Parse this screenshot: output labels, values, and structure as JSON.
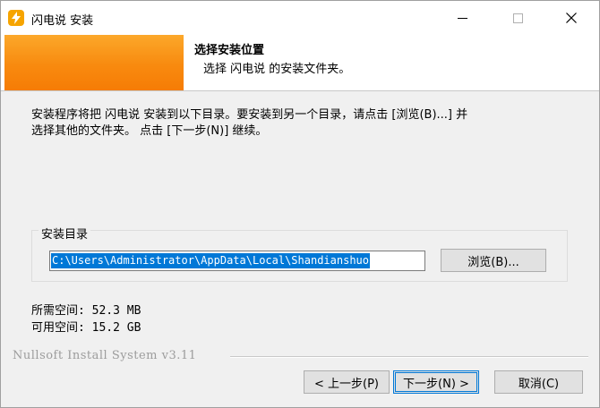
{
  "window": {
    "title": "闪电说 安装",
    "controls": {
      "minimize_icon": "minimize-icon",
      "maximize_icon": "maximize-icon",
      "close_icon": "close-icon"
    }
  },
  "header": {
    "title": "选择安装位置",
    "subtitle": "选择 闪电说 的安装文件夹。",
    "brand_color": "#f88a0f"
  },
  "body": {
    "intro_line1": "安装程序将把 闪电说 安装到以下目录。要安装到另一个目录，请点击 [浏览(B)...] 并",
    "intro_line2": "选择其他的文件夹。 点击 [下一步(N)] 继续。"
  },
  "install_dir": {
    "label": "安装目录",
    "value": "C:\\Users\\Administrator\\AppData\\Local\\Shandianshuo",
    "browse_label": "浏览(B)..."
  },
  "space": {
    "required": "所需空间: 52.3 MB",
    "available": "可用空间: 15.2 GB"
  },
  "footer": {
    "branding": "Nullsoft Install System v3.11",
    "back_label": "< 上一步(P)",
    "next_label": "下一步(N) >",
    "cancel_label": "取消(C)"
  },
  "colors": {
    "selection": "#0078d7",
    "accent": "#f88a0f",
    "icon": "#f6a400"
  }
}
